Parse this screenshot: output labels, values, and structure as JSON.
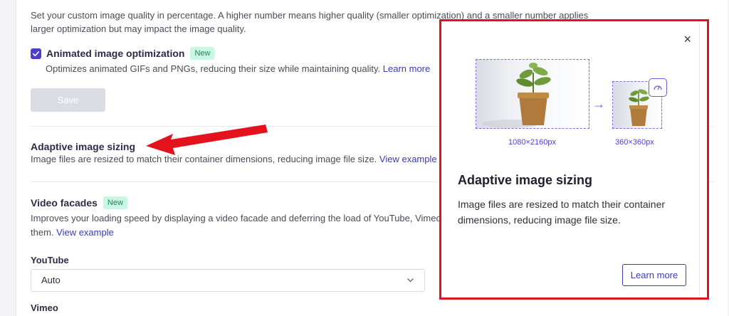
{
  "settings": {
    "quality_description": "Set your custom image quality in percentage. A higher number means higher quality (smaller optimization) and a smaller number applies larger optimization but may impact the image quality.",
    "animated": {
      "label": "Animated image optimization",
      "badge": "New",
      "checked": true,
      "description": "Optimizes animated GIFs and PNGs, reducing their size while maintaining quality.",
      "link": "Learn more"
    },
    "save_label": "Save",
    "adaptive": {
      "title": "Adaptive image sizing",
      "description": "Image files are resized to match their container dimensions, reducing image file size.",
      "link": "View example"
    },
    "video_facades": {
      "title": "Video facades",
      "badge": "New",
      "description": "Improves your loading speed by displaying a video facade and deferring the load of YouTube, Vimeo",
      "description_cont": "them.",
      "link": "View example"
    },
    "youtube": {
      "label": "YouTube",
      "value": "Auto"
    },
    "vimeo": {
      "label": "Vimeo"
    }
  },
  "popup": {
    "close": "×",
    "large_dim": "1080×2160px",
    "small_dim": "360×360px",
    "title": "Adaptive image sizing",
    "description": "Image files are resized to match their container dimensions, reducing image file size.",
    "button": "Learn more"
  },
  "colors": {
    "accent": "#4c3fc9",
    "link": "#3a3ab8",
    "badge_bg": "#c8f7e3",
    "highlight": "#e3121c"
  },
  "icons": {
    "checkbox": "check-icon",
    "chevron": "chevron-down-icon",
    "close": "close-icon",
    "speed": "gauge-icon",
    "arrow": "arrow-right-icon"
  }
}
